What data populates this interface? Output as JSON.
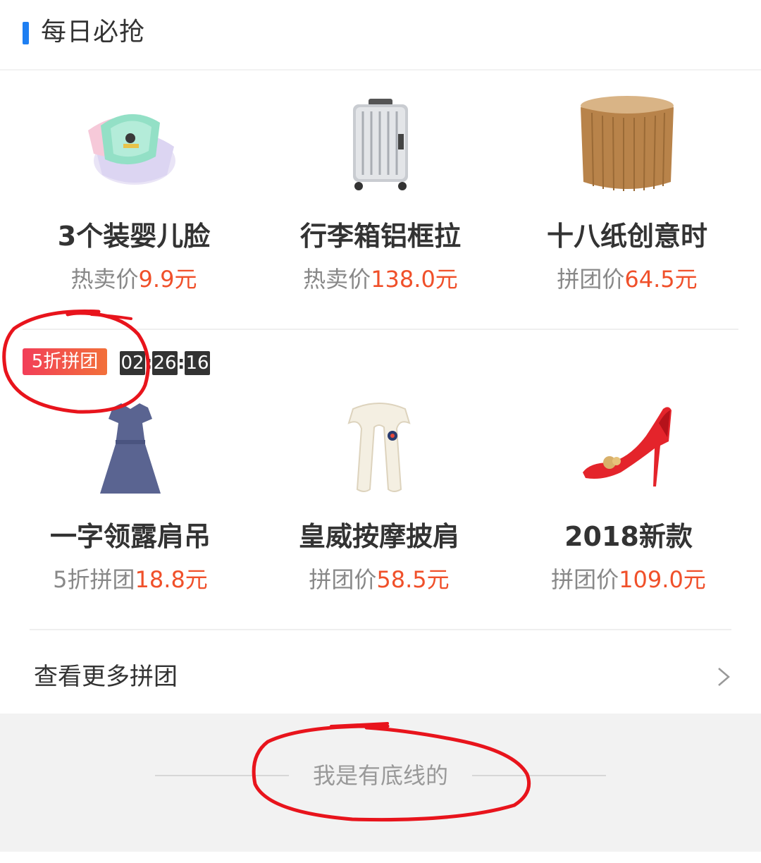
{
  "header": {
    "title": "每日必抢"
  },
  "row1": [
    {
      "name": "3个装婴儿脸",
      "price_label": "热卖价",
      "price": "9.9元",
      "image_icon": "basin-icon"
    },
    {
      "name": "行李箱铝框拉",
      "price_label": "热卖价",
      "price": "138.0元",
      "image_icon": "suitcase-icon"
    },
    {
      "name": "十八纸创意时",
      "price_label": "拼团价",
      "price": "64.5元",
      "image_icon": "stool-icon"
    }
  ],
  "promo": {
    "badge": "5折拼团",
    "timer": {
      "hours": "02",
      "minutes": "26",
      "seconds": "16"
    }
  },
  "row2": [
    {
      "name": "一字领露肩吊",
      "price_label": "5折拼团",
      "price": "18.8元",
      "image_icon": "dress-icon"
    },
    {
      "name": "皇威按摩披肩",
      "price_label": "拼团价",
      "price": "58.5元",
      "image_icon": "massager-icon"
    },
    {
      "name": "2018新款",
      "price_label": "拼团价",
      "price": "109.0元",
      "image_icon": "heel-shoe-icon"
    }
  ],
  "more": {
    "label": "查看更多拼团"
  },
  "footer": {
    "text": "我是有底线的"
  },
  "colors": {
    "accent": "#1e7ff2",
    "price": "#f0502a",
    "badge_start": "#f23e58",
    "badge_end": "#f2703a",
    "annotation": "#e8141c"
  }
}
